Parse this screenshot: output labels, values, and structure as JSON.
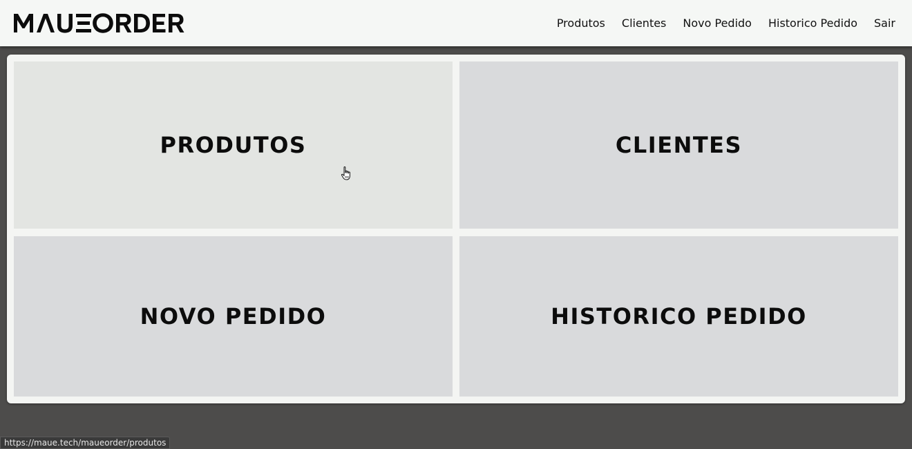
{
  "brand": {
    "name": "MAUEORDER"
  },
  "nav": {
    "items": [
      {
        "label": "Produtos"
      },
      {
        "label": "Clientes"
      },
      {
        "label": "Novo Pedido"
      },
      {
        "label": "Historico Pedido"
      },
      {
        "label": "Sair"
      }
    ]
  },
  "tiles": [
    {
      "label": "PRODUTOS"
    },
    {
      "label": "CLIENTES"
    },
    {
      "label": "NOVO PEDIDO"
    },
    {
      "label": "HISTORICO PEDIDO"
    }
  ],
  "status_bar": {
    "url": "https://maue.tech/maueorder/produtos"
  },
  "colors": {
    "navbar_bg": "#f5f7f5",
    "page_bg": "#4d4c4b",
    "tile_bg": "#d9dadc",
    "tile_hover_bg": "#e3e5e2",
    "text": "#0c0c0c"
  },
  "icons": {
    "cursor": "hand-pointer-icon"
  }
}
